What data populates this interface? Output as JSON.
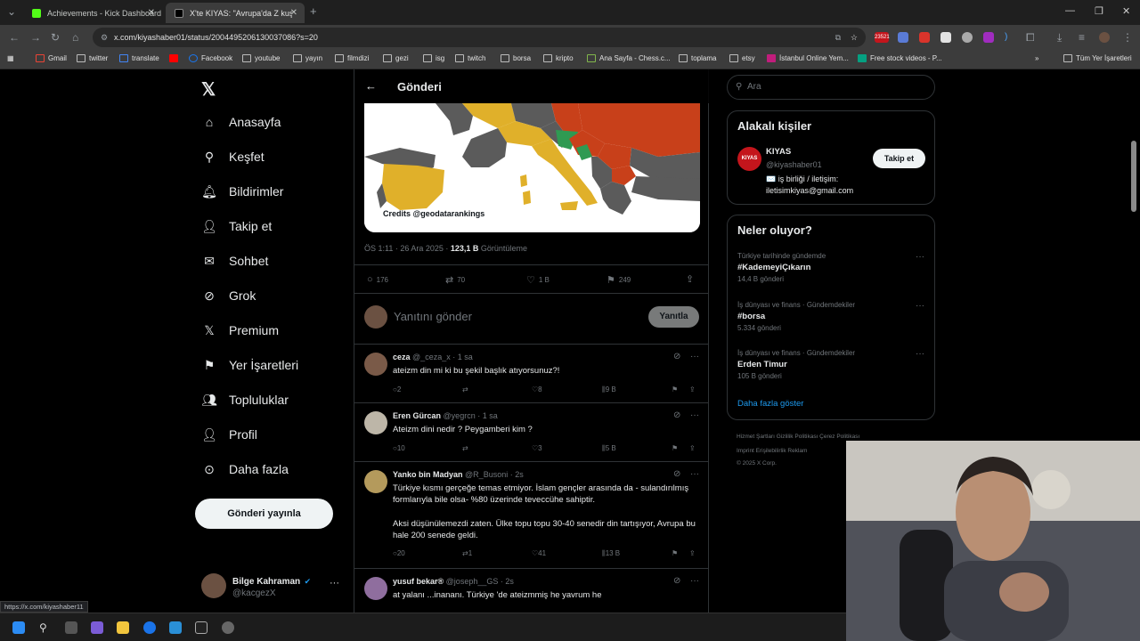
{
  "browser": {
    "tabs": [
      {
        "label": "Achievements - Kick Dashboard",
        "color": "#53fc18"
      },
      {
        "label": "X'te KIYAS: \"Avrupa'da Z kuşağı",
        "color": "#ffffff"
      }
    ],
    "url": "x.com/kiyashaber01/status/2004495206130037086?s=20",
    "notification_badge": "23521",
    "bookmarks": [
      "Gmail",
      "twitter",
      "translate",
      "Facebook",
      "youtube",
      "yayın",
      "filmdizi",
      "gezi",
      "isg",
      "twitch",
      "borsa",
      "kripto",
      "Ana Sayfa - Chess.c...",
      "toplama",
      "etsy",
      "İstanbul Online Yem...",
      "Free stock videos - P..."
    ],
    "all_bookmarks": "Tüm Yer İşaretleri"
  },
  "nav": {
    "items": [
      "Anasayfa",
      "Keşfet",
      "Bildirimler",
      "Takip et",
      "Sohbet",
      "Grok",
      "Premium",
      "Yer İşaretleri",
      "Topluluklar",
      "Profil",
      "Daha fazla"
    ],
    "icons": [
      "home-icon",
      "search-icon",
      "bell-icon",
      "person-add-icon",
      "mail-icon",
      "grok-icon",
      "x-premium-icon",
      "bookmark-icon",
      "communities-icon",
      "profile-icon",
      "more-circle-icon"
    ],
    "post_button": "Gönderi yayınla",
    "account_name": "Bilge Kahraman",
    "account_handle": "@kacgezX",
    "account_more": "···"
  },
  "post": {
    "header_title": "Gönderi",
    "map_credit": "Credits @geodatarankings",
    "time": "ÖS 1:11 · 26 Ara 2025 · ",
    "views_count": "123,1 B",
    "views_label": " Görüntüleme",
    "replies": "176",
    "reposts": "70",
    "likes": "1 B",
    "bookmarks": "249",
    "reply_placeholder": "Yanıtını gönder",
    "reply_button": "Yanıtla"
  },
  "replies": [
    {
      "name": "ceza",
      "handle": "@_ceza_x · 1 sa",
      "text": "ateizm din mi ki bu şekil başlık atıyorsunuz?!",
      "replies": "2",
      "reposts": "",
      "likes": "8",
      "views": "9 B"
    },
    {
      "name": "Eren Gürcan",
      "handle": "@yegrcn · 1 sa",
      "text": "Ateizm dini nedir ? Peygamberi kim ?",
      "replies": "10",
      "reposts": "",
      "likes": "3",
      "views": "5 B"
    },
    {
      "name": "Yanko bin Madyan",
      "handle": "@R_Busoni · 2s",
      "text": "Türkiye kısmı gerçeğe temas etmiyor. İslam gençler arasında da - sulandırılmış formlarıyla bile olsa- %80 üzerinde teveccühe sahiptir.",
      "text2": "Aksi düşünülemezdi zaten. Ülke topu topu 30-40 senedir din tartışıyor, Avrupa bu hale 200 senede geldi.",
      "replies": "20",
      "reposts": "1",
      "likes": "41",
      "views": "13 B"
    },
    {
      "name": "yusuf bekar®",
      "handle": "@joseph__GS · 2s",
      "text": "at yalanı ...inananı. Türkiye 'de ateizmmiş he yavrum he"
    }
  ],
  "sidebar": {
    "search_placeholder": "Ara",
    "related_title": "Alakalı kişiler",
    "related_name": "KIYAS",
    "related_handle": "@kiyashaber01",
    "related_bio1": "✉️ iş birliği / iletişim:",
    "related_bio2": "iletisimkiyas@gmail.com",
    "follow_button": "Takip et",
    "avatar_text": "KIYAS",
    "trends_title": "Neler oluyor?",
    "trends": [
      {
        "context": "Türkiye tarihinde gündemde",
        "topic": "#KademeyiÇıkarın",
        "posts": "14,4 B gönderi"
      },
      {
        "context": "İş dünyası ve finans · Gündemdekiler",
        "topic": "#borsa",
        "posts": "5.334 gönderi"
      },
      {
        "context": "İş dünyası ve finans · Gündemdekiler",
        "topic": "Erden Timur",
        "posts": "105 B gönderi"
      }
    ],
    "show_more": "Daha fazla göster",
    "footer1": "Hizmet Şartları    Gizlilik Politikası    Çerez Politikası",
    "footer2": "Imprint    Erişilebilirlik    Reklam",
    "footer3": "© 2025 X Corp."
  },
  "status_url": "https://x.com/kiyashaber11",
  "colors": {
    "accent": "#1d9bf0",
    "map_yellow": "#e0b02a",
    "map_red": "#c8401a",
    "map_green": "#2f9a52",
    "map_gray": "#5b5b5b"
  }
}
